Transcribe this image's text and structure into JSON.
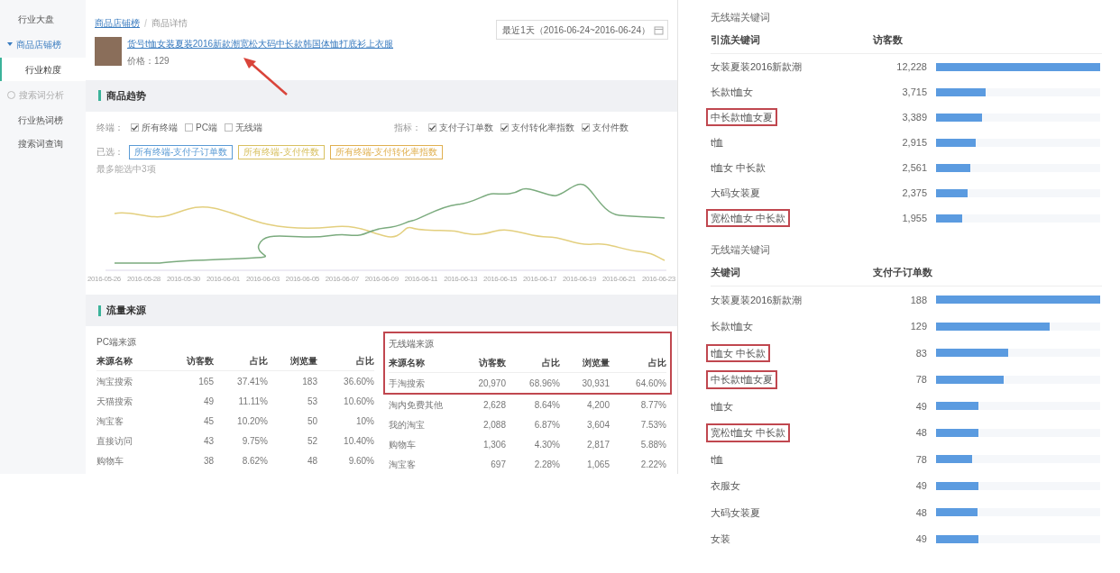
{
  "sidebar": {
    "items": [
      {
        "label": "行业大盘",
        "kind": "item",
        "selected": false
      },
      {
        "label": "商品店铺榜",
        "kind": "group",
        "expanded": true
      },
      {
        "label": "行业粒度",
        "kind": "item",
        "selected": true
      },
      {
        "label": "搜索词分析",
        "kind": "group",
        "expanded": false
      },
      {
        "label": "行业热词榜",
        "kind": "item",
        "selected": false
      },
      {
        "label": "搜索词查询",
        "kind": "item",
        "selected": false
      }
    ]
  },
  "breadcrumb": [
    "商品店铺榜",
    "商品详情"
  ],
  "product": {
    "title": "货号t恤女装夏装2016新款潮宽松大码中长款韩国体恤打底衫上衣服",
    "price": "价格：129"
  },
  "date_range": "最近1天（2016-06-24~2016-06-24）",
  "trend": {
    "title": "商品趋势",
    "terminal_label": "终端：",
    "terminal_options": [
      {
        "label": "所有终端",
        "checked": true
      },
      {
        "label": "PC端",
        "checked": false
      },
      {
        "label": "无线端",
        "checked": false
      }
    ],
    "metric_label": "指标：",
    "metric_options": [
      {
        "label": "支付子订单数",
        "checked": true
      },
      {
        "label": "支付转化率指数",
        "checked": true
      },
      {
        "label": "支付件数",
        "checked": true
      }
    ],
    "selected_label": "已选：",
    "selected_tags": [
      {
        "label": "所有终端-支付子订单数",
        "color": "#5b9bd5"
      },
      {
        "label": "所有终端-支付件数",
        "color": "#d8c060"
      },
      {
        "label": "所有终端-支付转化率指数",
        "color": "#e0b050"
      }
    ],
    "hint": "最多能选中3项",
    "x_labels": [
      "2016-05-26",
      "2016-05-28",
      "2016-05-30",
      "2016-06-01",
      "2016-06-03",
      "2016-06-05",
      "2016-06-07",
      "2016-06-09",
      "2016-06-11",
      "2016-06-13",
      "2016-06-15",
      "2016-06-17",
      "2016-06-19",
      "2016-06-21",
      "2016-06-23"
    ]
  },
  "traffic": {
    "title": "流量来源",
    "tables": [
      {
        "title": "PC端来源",
        "highlighted": false,
        "columns": [
          "来源名称",
          "访客数",
          "占比",
          "浏览量",
          "占比"
        ],
        "rows": [
          {
            "cells": [
              "淘宝搜索",
              "165",
              "37.41%",
              "183",
              "36.60%"
            ],
            "highlighted": false
          },
          {
            "cells": [
              "天猫搜索",
              "49",
              "11.11%",
              "53",
              "10.60%"
            ],
            "highlighted": false
          },
          {
            "cells": [
              "淘宝客",
              "45",
              "10.20%",
              "50",
              "10%"
            ],
            "highlighted": false
          },
          {
            "cells": [
              "直接访问",
              "43",
              "9.75%",
              "52",
              "10.40%"
            ],
            "highlighted": false
          },
          {
            "cells": [
              "购物车",
              "38",
              "8.62%",
              "48",
              "9.60%"
            ],
            "highlighted": false
          }
        ]
      },
      {
        "title": "无线端来源",
        "highlighted": true,
        "columns": [
          "来源名称",
          "访客数",
          "占比",
          "浏览量",
          "占比"
        ],
        "rows": [
          {
            "cells": [
              "手淘搜索",
              "20,970",
              "68.96%",
              "30,931",
              "64.60%"
            ],
            "highlighted": true
          },
          {
            "cells": [
              "淘内免费其他",
              "2,628",
              "8.64%",
              "4,200",
              "8.77%"
            ],
            "highlighted": false
          },
          {
            "cells": [
              "我的淘宝",
              "2,088",
              "6.87%",
              "3,604",
              "7.53%"
            ],
            "highlighted": false
          },
          {
            "cells": [
              "购物车",
              "1,306",
              "4.30%",
              "2,817",
              "5.88%"
            ],
            "highlighted": false
          },
          {
            "cells": [
              "淘宝客",
              "697",
              "2.28%",
              "1,065",
              "2.22%"
            ],
            "highlighted": false
          }
        ]
      }
    ]
  },
  "keyword_tables": [
    {
      "title": "无线端关键词",
      "columns": [
        "引流关键词",
        "访客数"
      ],
      "rows": [
        {
          "keyword": "女装夏装2016新款潮",
          "value": "12,228",
          "level": 1,
          "highlighted": false
        },
        {
          "keyword": "长款t恤女",
          "value": "3,715",
          "level": 0.3,
          "highlighted": false
        },
        {
          "keyword": "中长款t恤女夏",
          "value": "3,389",
          "level": 0.28,
          "highlighted": true
        },
        {
          "keyword": "t恤",
          "value": "2,915",
          "level": 0.24,
          "highlighted": false
        },
        {
          "keyword": "t恤女 中长款",
          "value": "2,561",
          "level": 0.21,
          "highlighted": false
        },
        {
          "keyword": "大码女装夏",
          "value": "2,375",
          "level": 0.19,
          "highlighted": false
        },
        {
          "keyword": "宽松t恤女 中长款",
          "value": "1,955",
          "level": 0.16,
          "highlighted": true
        }
      ]
    },
    {
      "title": "无线端关键词",
      "columns": [
        "关键词",
        "支付子订单数"
      ],
      "rows": [
        {
          "keyword": "女装夏装2016新款潮",
          "value": "188",
          "level": 1,
          "highlighted": false
        },
        {
          "keyword": "长款t恤女",
          "value": "129",
          "level": 0.69,
          "highlighted": false
        },
        {
          "keyword": "t恤女 中长款",
          "value": "83",
          "level": 0.44,
          "highlighted": true
        },
        {
          "keyword": "中长款t恤女夏",
          "value": "78",
          "level": 0.41,
          "highlighted": true
        },
        {
          "keyword": "t恤女",
          "value": "49",
          "level": 0.26,
          "highlighted": false
        },
        {
          "keyword": "宽松t恤女 中长款",
          "value": "48",
          "level": 0.26,
          "highlighted": true
        },
        {
          "keyword": "t恤",
          "value": "78",
          "level": 0.22,
          "highlighted": false
        },
        {
          "keyword": "衣服女",
          "value": "49",
          "level": 0.26,
          "highlighted": false
        },
        {
          "keyword": "大码女装夏",
          "value": "48",
          "level": 0.25,
          "highlighted": false
        },
        {
          "keyword": "女装",
          "value": "49",
          "level": 0.26,
          "highlighted": false
        }
      ]
    }
  ]
}
